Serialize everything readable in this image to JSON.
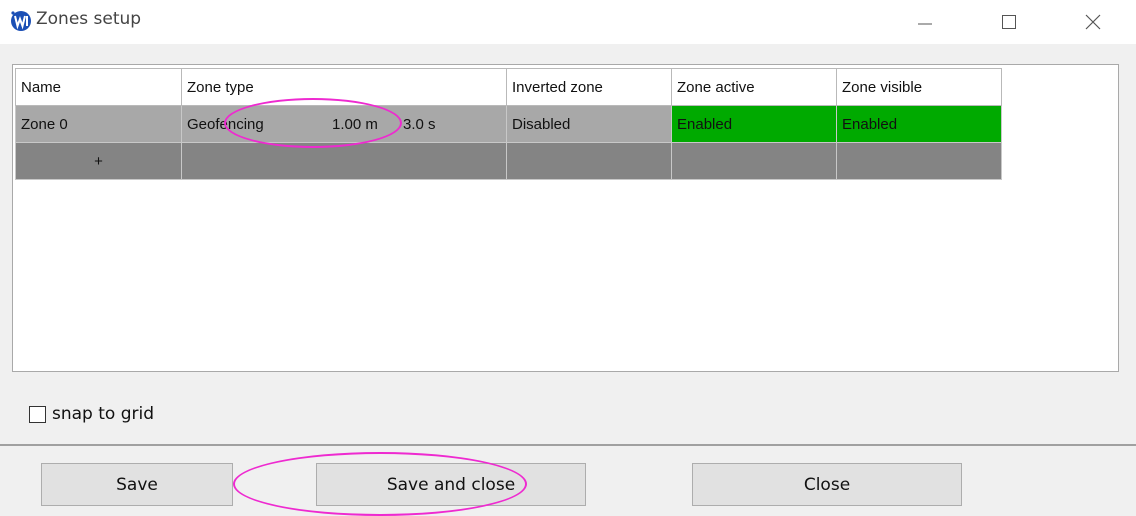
{
  "window": {
    "title": "Zones setup",
    "minimize_icon": "minimize-icon",
    "maximize_icon": "maximize-icon",
    "close_icon": "close-icon"
  },
  "grid": {
    "columns": [
      "Name",
      "Zone type",
      "Inverted zone",
      "Zone active",
      "Zone visible"
    ],
    "rows": [
      {
        "name": "Zone 0",
        "zone_type": "Geofencing",
        "distance": "1.00 m",
        "time": "3.0 s",
        "inverted": "Disabled",
        "active": "Enabled",
        "visible": "Enabled"
      }
    ],
    "add_row_label": "+"
  },
  "options": {
    "snap_to_grid_label": "snap to grid",
    "snap_to_grid_checked": false
  },
  "buttons": {
    "save": "Save",
    "save_and_close": "Save and close",
    "close": "Close"
  },
  "colors": {
    "enabled": "#00aa00",
    "row": "#a8a8a8",
    "add_row": "#848484",
    "annotation": "#ee2ad0"
  }
}
